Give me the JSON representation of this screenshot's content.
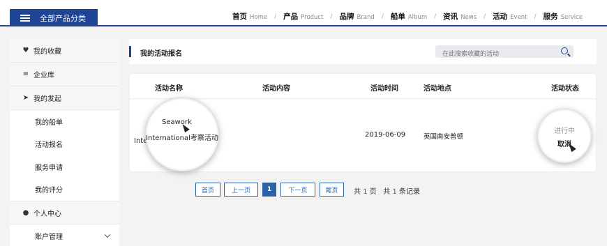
{
  "header": {
    "category_button": "全部产品分类",
    "nav": [
      {
        "zh": "首页",
        "en": "Home"
      },
      {
        "zh": "产品",
        "en": "Product"
      },
      {
        "zh": "品牌",
        "en": "Brand"
      },
      {
        "zh": "船单",
        "en": "Album"
      },
      {
        "zh": "资讯",
        "en": "News"
      },
      {
        "zh": "活动",
        "en": "Event"
      },
      {
        "zh": "服务",
        "en": "Service"
      }
    ],
    "nav_separator": "/"
  },
  "sidebar": {
    "items": [
      {
        "label": "我的收藏",
        "icon": "heart-icon"
      },
      {
        "label": "企业库",
        "icon": "list-icon"
      },
      {
        "label": "我的发起",
        "icon": "paper-plane-icon"
      },
      {
        "label": "我的船单"
      },
      {
        "label": "活动报名"
      },
      {
        "label": "服务申请"
      },
      {
        "label": "我的评分"
      },
      {
        "label": "个人中心",
        "icon": "user-icon"
      },
      {
        "label": "账户管理"
      }
    ]
  },
  "main": {
    "title": "我的活动报名",
    "search_placeholder": "在此搜索收藏的活动",
    "table": {
      "headers": [
        "活动名称",
        "活动内容",
        "活动时间",
        "活动地点",
        "活动状态"
      ],
      "rows": [
        {
          "name_line1": "Seawork",
          "name_line2": "International考察活动",
          "name_clip": "Inte",
          "content": "",
          "time": "2019-06-09",
          "location": "英国南安普顿",
          "status": "进行中",
          "action": "取消"
        }
      ]
    }
  },
  "pagination": {
    "first": "首页",
    "prev": "上一页",
    "current": "1",
    "next": "下一页",
    "last": "尾页",
    "info_prefix": "共",
    "pages": "1",
    "pages_suffix": "页",
    "info_prefix2": "共",
    "records": "1",
    "records_suffix": "条记录"
  },
  "colors": {
    "brand": "#1f4496",
    "link": "#2b62a8"
  }
}
